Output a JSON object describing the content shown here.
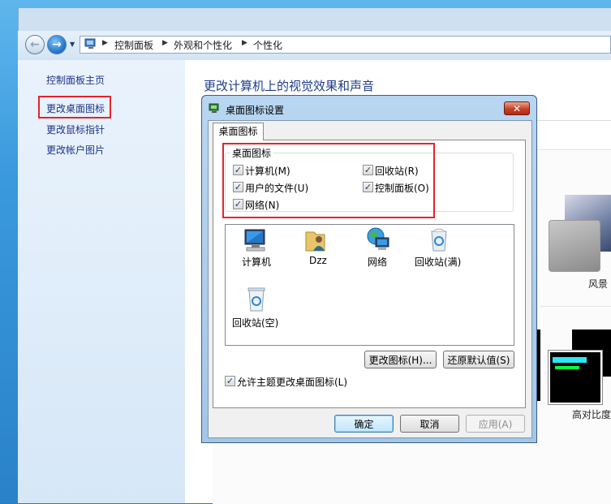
{
  "address": {
    "crumbs": [
      "控制面板",
      "外观和个性化",
      "个性化"
    ]
  },
  "sidebar": {
    "items": [
      {
        "label": "控制面板主页"
      },
      {
        "label": "更改桌面图标"
      },
      {
        "label": "更改鼠标指针"
      },
      {
        "label": "更改帐户图片"
      }
    ]
  },
  "main": {
    "title": "更改计算机上的视觉效果和声音",
    "themes": [
      {
        "label": "风景"
      },
      {
        "label": "高对比度"
      }
    ]
  },
  "dialog": {
    "title": "桌面图标设置",
    "close_symbol": "✕",
    "tab": "桌面图标",
    "group_title": "桌面图标",
    "checkboxes": [
      {
        "label": "计算机(M)",
        "checked": true
      },
      {
        "label": "回收站(R)",
        "checked": true
      },
      {
        "label": "用户的文件(U)",
        "checked": true
      },
      {
        "label": "控制面板(O)",
        "checked": true
      },
      {
        "label": "网络(N)",
        "checked": true
      }
    ],
    "check_glyph": "✓",
    "icons": [
      {
        "label": "计算机",
        "icon": "computer-icon"
      },
      {
        "label": "Dzz",
        "icon": "user-folder-icon"
      },
      {
        "label": "网络",
        "icon": "network-icon"
      },
      {
        "label": "回收站(满)",
        "icon": "recycle-bin-full-icon"
      },
      {
        "label": "回收站(空)",
        "icon": "recycle-bin-empty-icon"
      }
    ],
    "change_icon_btn": "更改图标(H)...",
    "restore_default_btn": "还原默认值(S)",
    "allow_themes_label": "允许主题更改桌面图标(L)",
    "allow_themes_checked": true,
    "ok_btn": "确定",
    "cancel_btn": "取消",
    "apply_btn": "应用(A)"
  }
}
